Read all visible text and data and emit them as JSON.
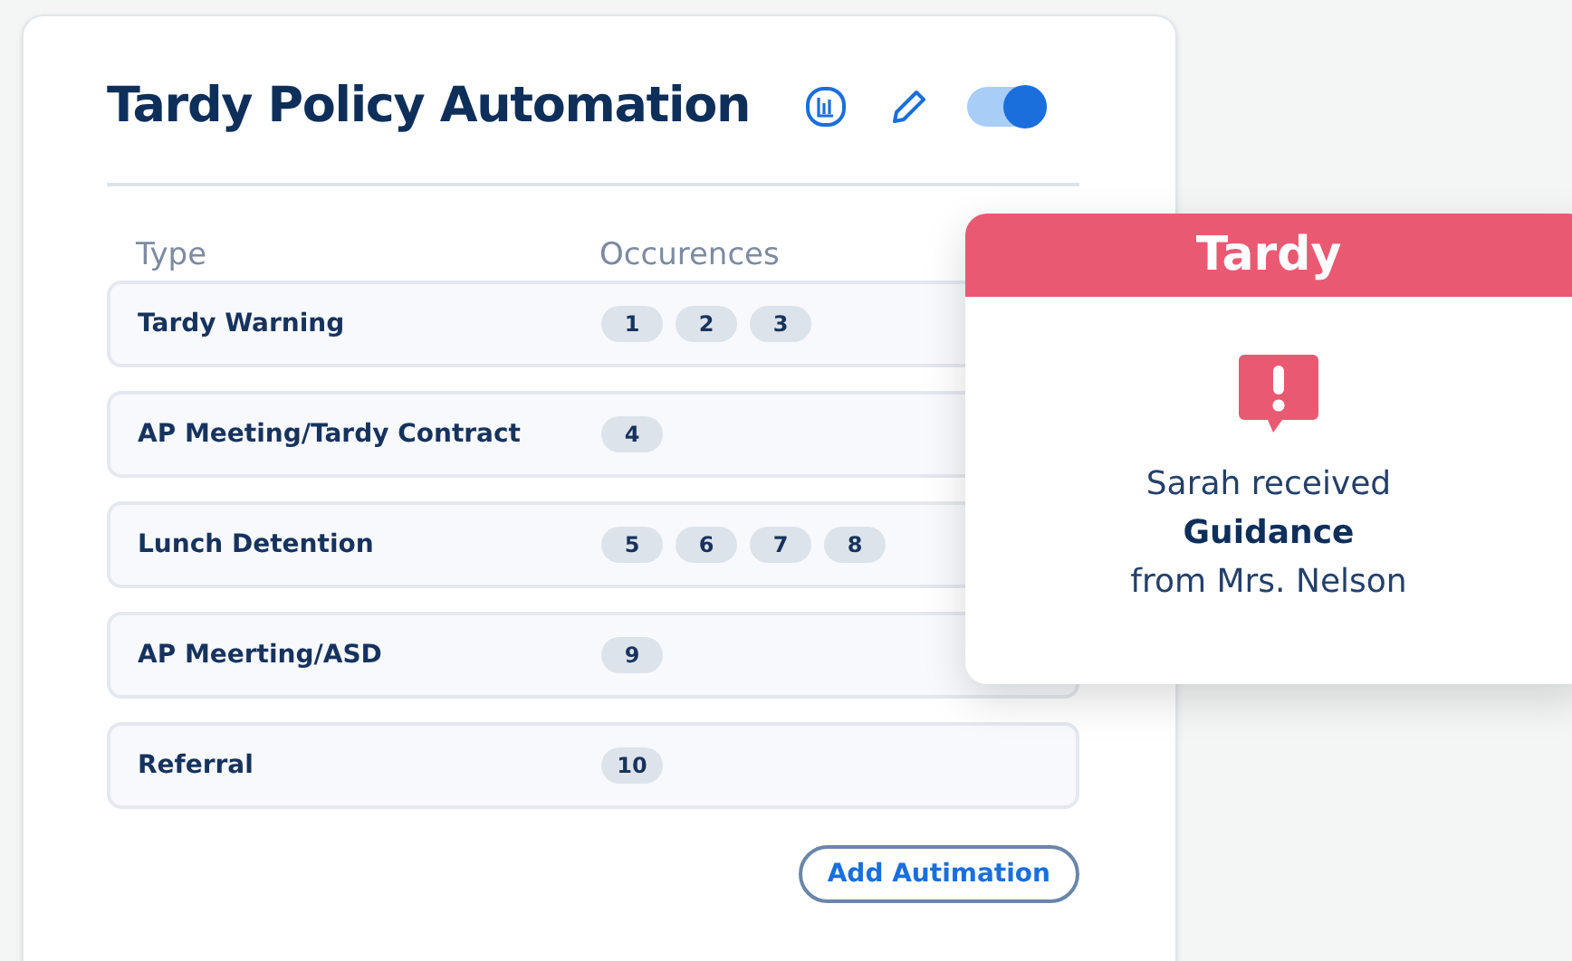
{
  "card": {
    "title": "Tardy Policy Automation",
    "enabled": {
      "on": true
    }
  },
  "table": {
    "columns": [
      "Type",
      "Occurences"
    ],
    "rows": [
      {
        "type": "Tardy Warning",
        "occurrences": [
          "1",
          "2",
          "3"
        ]
      },
      {
        "type": "AP Meeting/Tardy Contract",
        "occurrences": [
          "4"
        ]
      },
      {
        "type": "Lunch Detention",
        "occurrences": [
          "5",
          "6",
          "7",
          "8"
        ]
      },
      {
        "type": "AP Meerting/ASD",
        "occurrences": [
          "9"
        ]
      },
      {
        "type": "Referral",
        "occurrences": [
          "10"
        ]
      }
    ]
  },
  "add_button": "Add Autimation",
  "notification": {
    "title": "Tardy",
    "lines": [
      "Sarah received",
      "Guidance",
      "from Mrs. Nelson"
    ]
  }
}
